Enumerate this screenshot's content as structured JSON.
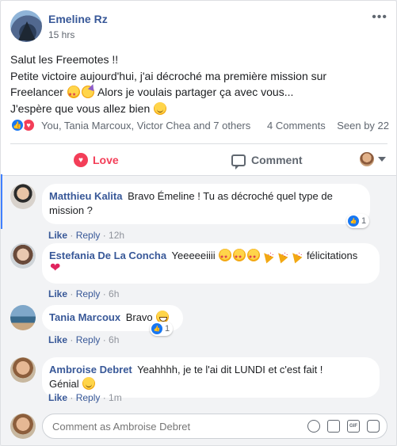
{
  "post": {
    "author": "Emeline Rz",
    "time": "15 hrs",
    "more_icon": "more-horizontal-icon",
    "lines": [
      "Salut les Freemotes !!",
      "Petite victoire aujourd'hui, j'ai décroché ma première mission sur",
      "Freelancer",
      "Alors je voulais partager ça avec vous...",
      "J'espère que vous allez bien"
    ]
  },
  "summary": {
    "names": "You, Tania Marcoux, Victor Chea and 7 others",
    "comments": "4 Comments",
    "seen": "Seen by 22"
  },
  "actions": {
    "love_label": "Love",
    "comment_label": "Comment"
  },
  "comments": [
    {
      "author": "Matthieu Kalita",
      "text": "Bravo Émeline ! Tu as décroché quel type de",
      "text2": "mission ?",
      "like": "Like",
      "reply": "Reply",
      "time": "12h",
      "reactions": "1"
    },
    {
      "author": "Estefania De La Concha",
      "text": "Yeeeeeiiii",
      "text2": "félicitations",
      "like": "Like",
      "reply": "Reply",
      "time": "6h"
    },
    {
      "author": "Tania Marcoux",
      "text": "Bravo",
      "like": "Like",
      "reply": "Reply",
      "time": "6h",
      "reactions": "1"
    },
    {
      "author": "Ambroise Debret",
      "text": "Yeahhhh, je te l'ai dit LUNDI et c'est fait !",
      "text2": "Génial",
      "like": "Like",
      "reply": "Reply",
      "time": "1m"
    }
  ],
  "composer": {
    "placeholder": "Comment as Ambroise Debret"
  },
  "colors": {
    "link": "#385898",
    "love": "#f33e58",
    "like": "#1877f2",
    "active_bar": "#4080ff"
  }
}
